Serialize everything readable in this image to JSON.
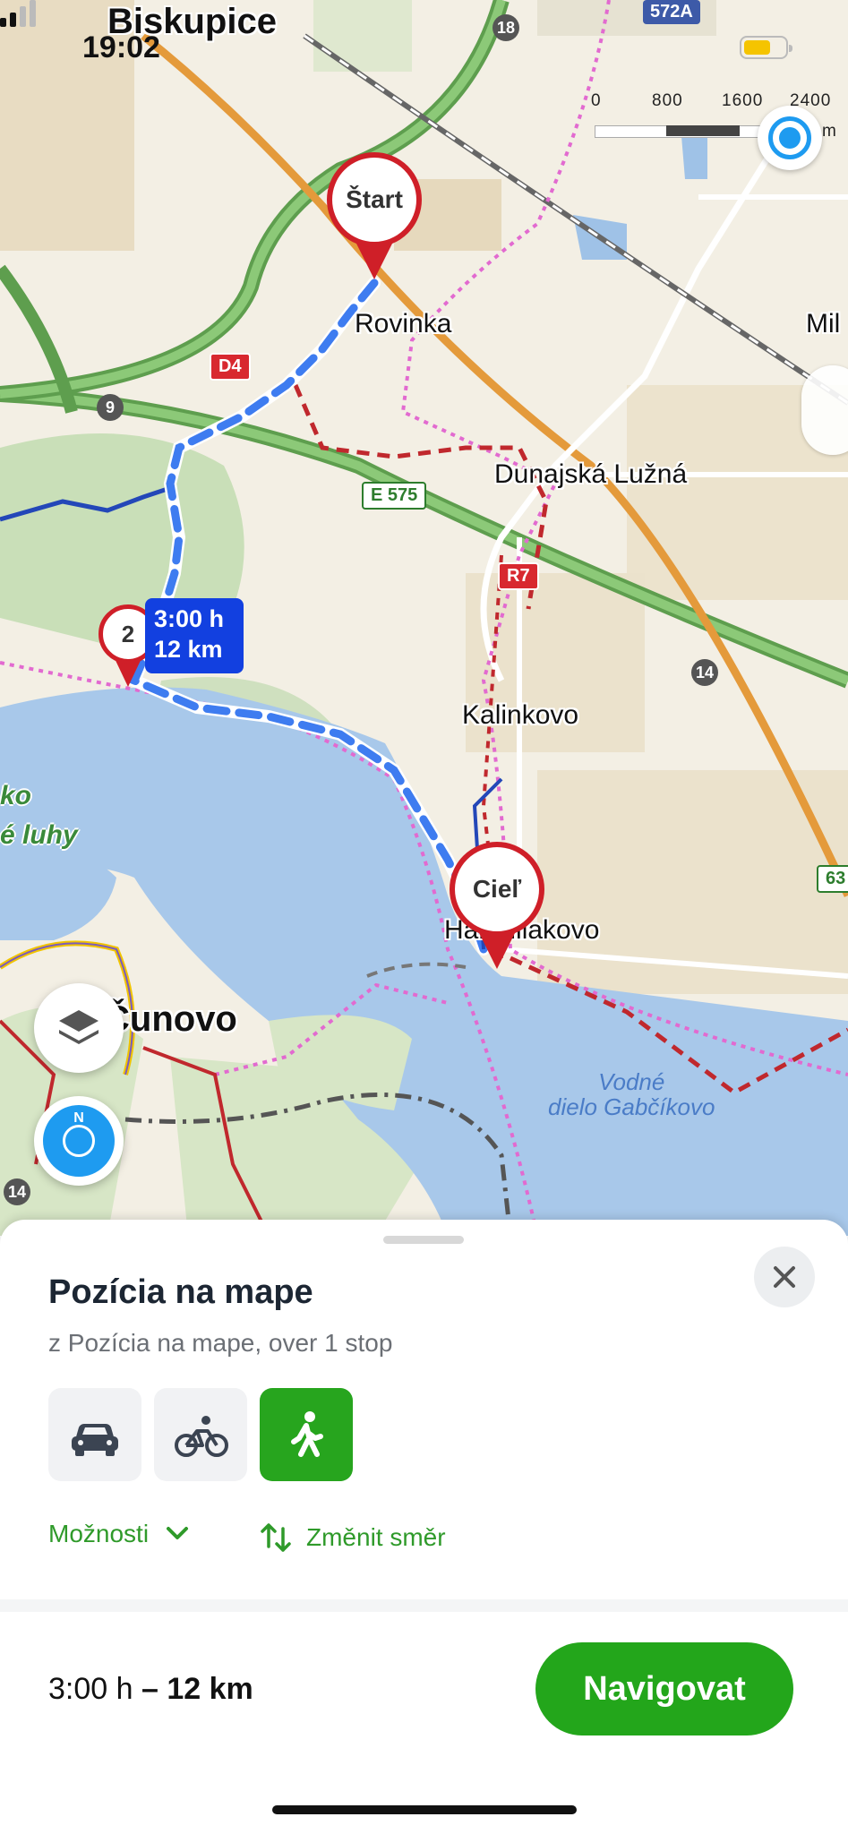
{
  "status_bar": {
    "time": "19:02"
  },
  "map": {
    "labels": {
      "biskupice": "Biskupice",
      "rovinka": "Rovinka",
      "mil": "Mil",
      "dunajska_luzna": "Dunajská Lužná",
      "kalinkovo": "Kalinkovo",
      "hamuliakovo": "Hamuliakovo",
      "cunovo": "Čunovo",
      "ko": "ko",
      "luhy": "é luhy",
      "vodne_dielo": "Vodné\ndielo Gabčíkovo"
    },
    "road_badges": {
      "r572a": "572A",
      "r18": "18",
      "d4": "D4",
      "r9": "9",
      "e575": "E 575",
      "r7": "R7",
      "r14": "14",
      "r63": "63",
      "r14_left": "14"
    },
    "scale": {
      "labels": [
        "0",
        "800",
        "1600",
        "2400"
      ],
      "unit": "m"
    },
    "pins": {
      "start": "Štart",
      "stop": "2",
      "end": "Cieľ"
    },
    "route_tag": {
      "time": "3:00 h",
      "distance": "12 km"
    },
    "compass_letter": "N",
    "colors": {
      "route": "#1240e0",
      "pin": "#cf1f28",
      "water": "#a8c8ea",
      "forest": "#cfe0bf"
    }
  },
  "sheet": {
    "title": "Pozícia na mape",
    "subtitle": "z Pozícia na mape, over 1 stop",
    "modes": [
      {
        "name": "car-icon",
        "active": false
      },
      {
        "name": "bike-icon",
        "active": false
      },
      {
        "name": "walk-icon",
        "active": true
      }
    ],
    "options_label": "Možnosti",
    "reverse_label": "Změnit směr",
    "summary_time": "3:00 h",
    "summary_sep": " – ",
    "summary_distance": "12 km",
    "navigate_label": "Navigovat",
    "accent": "#23a61b"
  }
}
